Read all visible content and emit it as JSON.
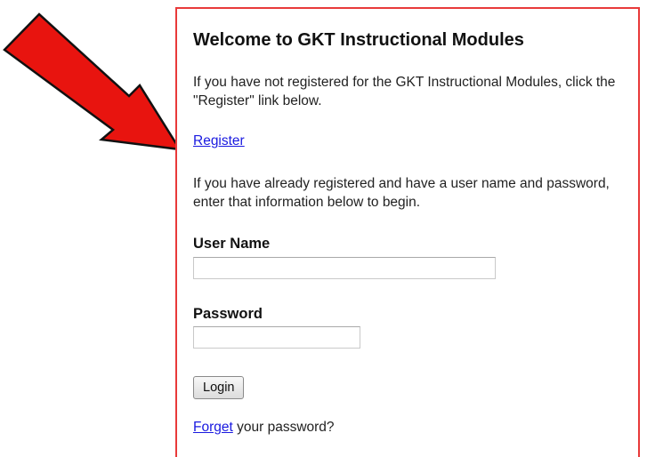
{
  "panel": {
    "title": "Welcome to GKT Instructional Modules",
    "intro_text": "If you have not registered for the GKT Instructional Modules, click the \"Register\" link below.",
    "register_link": "Register",
    "registered_text": "If you have already registered and have a user name and password, enter that information below to begin."
  },
  "form": {
    "username_label": "User Name",
    "username_value": "",
    "password_label": "Password",
    "password_value": "",
    "login_button": "Login"
  },
  "forgot": {
    "link": "Forget",
    "suffix": " your password?"
  },
  "annotation": {
    "arrow_icon": "red-arrow-icon",
    "arrow_color": "#e8140f",
    "border_color": "#e83a3a"
  }
}
